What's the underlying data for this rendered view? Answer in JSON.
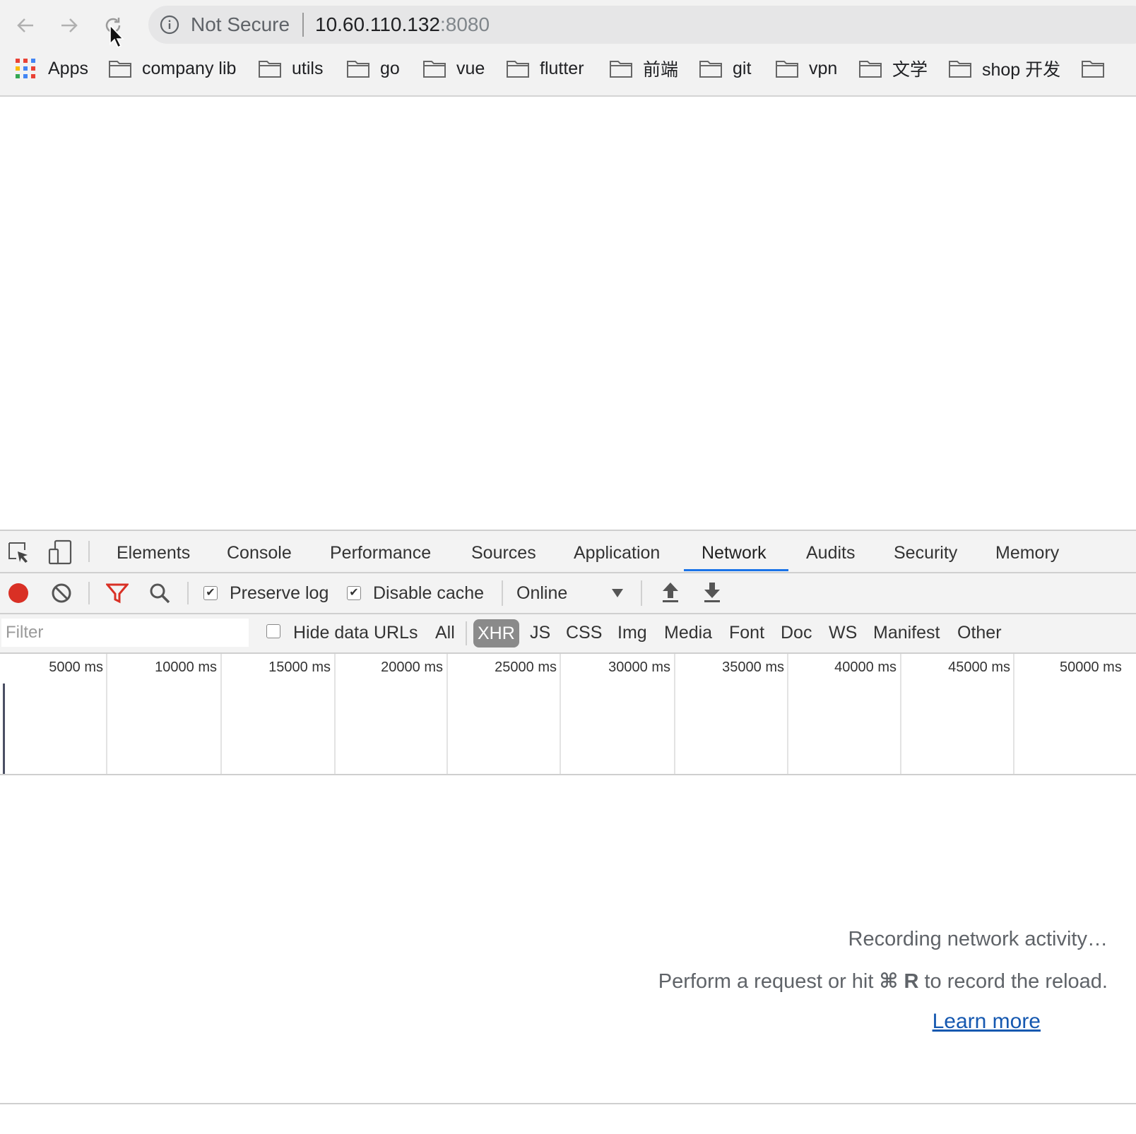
{
  "browser": {
    "security_label": "Not Secure",
    "url_host": "10.60.110.132",
    "url_port": ":8080",
    "bookmarks": [
      {
        "label": "Apps"
      },
      {
        "label": "company lib"
      },
      {
        "label": "utils"
      },
      {
        "label": "go"
      },
      {
        "label": "vue"
      },
      {
        "label": "flutter"
      },
      {
        "label": "前端"
      },
      {
        "label": "git"
      },
      {
        "label": "vpn"
      },
      {
        "label": "文学"
      },
      {
        "label": "shop 开发"
      }
    ]
  },
  "devtools": {
    "tabs": [
      {
        "label": "Elements"
      },
      {
        "label": "Console"
      },
      {
        "label": "Performance"
      },
      {
        "label": "Sources"
      },
      {
        "label": "Application"
      },
      {
        "label": "Network",
        "active": true
      },
      {
        "label": "Audits"
      },
      {
        "label": "Security"
      },
      {
        "label": "Memory"
      }
    ],
    "toolbar": {
      "preserve_log_label": "Preserve log",
      "preserve_log_checked": true,
      "disable_cache_label": "Disable cache",
      "disable_cache_checked": true,
      "throttling_value": "Online"
    },
    "filter": {
      "placeholder": "Filter",
      "hide_data_urls_label": "Hide data URLs",
      "hide_data_urls_checked": false,
      "types": [
        "All",
        "XHR",
        "JS",
        "CSS",
        "Img",
        "Media",
        "Font",
        "Doc",
        "WS",
        "Manifest",
        "Other"
      ],
      "active_type": "XHR"
    },
    "timeline_ticks": [
      "5000 ms",
      "10000 ms",
      "15000 ms",
      "20000 ms",
      "25000 ms",
      "30000 ms",
      "35000 ms",
      "40000 ms",
      "45000 ms",
      "50000 ms"
    ],
    "empty_state": {
      "line1": "Recording network activity…",
      "line2_prefix": "Perform a request or hit ",
      "line2_key": "⌘ R",
      "line2_suffix": " to record the reload.",
      "learn_more": "Learn more"
    }
  },
  "colors": {
    "record": "#d93025",
    "filter_icon": "#d93025",
    "active_tab_underline": "#1a73e8",
    "link": "#1558b0"
  }
}
